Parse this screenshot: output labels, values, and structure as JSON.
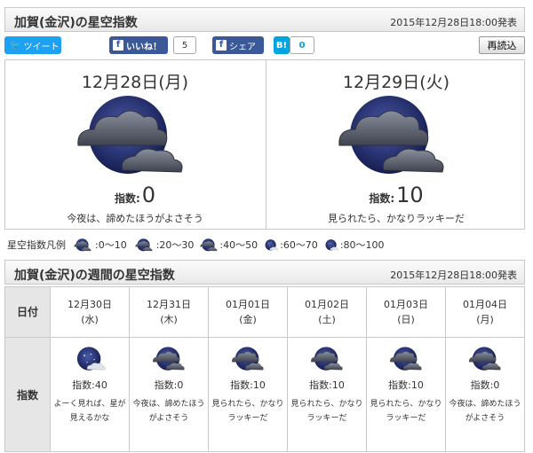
{
  "header": {
    "title": "加賀(金沢)の星空指数",
    "published": "2015年12月28日18:00発表"
  },
  "social": {
    "tweet": "ツイート",
    "like": "いいね！",
    "like_count": "5",
    "share": "シェア",
    "hatena": "B!",
    "hatena_count": "0",
    "reload": "再読込"
  },
  "days": [
    {
      "date": "12月28日(月)",
      "score_label": "指数:",
      "score": "0",
      "message": "今夜は、諦めたほうがよさそう",
      "icon": "cloudy-night-icon"
    },
    {
      "date": "12月29日(火)",
      "score_label": "指数:",
      "score": "10",
      "message": "見られたら、かなりラッキーだ",
      "icon": "cloudy-night-icon"
    }
  ],
  "legend": {
    "label": "星空指数凡例",
    "items": [
      ":0〜10",
      ":20〜30",
      ":40〜50",
      ":60〜70",
      ":80〜100"
    ]
  },
  "weekly": {
    "title": "加賀(金沢)の週間の星空指数",
    "published": "2015年12月28日18:00発表",
    "row_date": "日付",
    "row_index": "指数",
    "days": [
      {
        "date": "12月30日",
        "dow": "(水)",
        "score": "指数:40",
        "msg1": "よーく見れば、星が",
        "msg2": "見えるかな",
        "icon": "partly-cloudy-stars-icon"
      },
      {
        "date": "12月31日",
        "dow": "(木)",
        "score": "指数:0",
        "msg1": "今夜は、諦めたほう",
        "msg2": "がよさそう",
        "icon": "cloudy-night-icon"
      },
      {
        "date": "01月01日",
        "dow": "(金)",
        "score": "指数:10",
        "msg1": "見られたら、かなり",
        "msg2": "ラッキーだ",
        "icon": "cloudy-night-icon"
      },
      {
        "date": "01月02日",
        "dow": "(土)",
        "score": "指数:10",
        "msg1": "見られたら、かなり",
        "msg2": "ラッキーだ",
        "icon": "cloudy-night-icon"
      },
      {
        "date": "01月03日",
        "dow": "(日)",
        "score": "指数:10",
        "msg1": "見られたら、かなり",
        "msg2": "ラッキーだ",
        "icon": "cloudy-night-icon"
      },
      {
        "date": "01月04日",
        "dow": "(月)",
        "score": "指数:0",
        "msg1": "今夜は、諦めたほう",
        "msg2": "がよさそう",
        "icon": "cloudy-night-icon"
      }
    ]
  }
}
